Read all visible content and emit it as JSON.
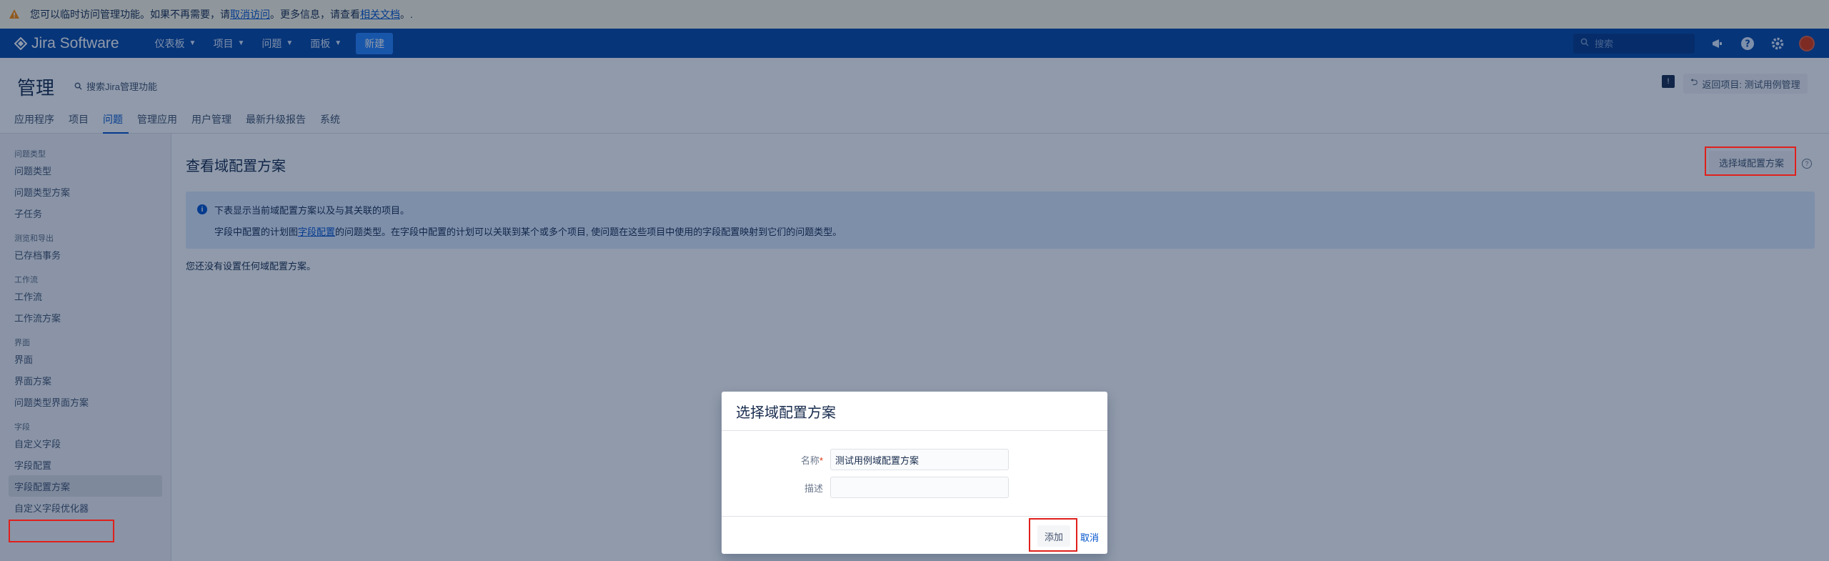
{
  "banner": {
    "text_before": "您可以临时访问管理功能。如果不再需要，请 ",
    "link1": "取消访问",
    "text_middle": "。更多信息，请查看 ",
    "link2": "相关文档",
    "text_after": "。."
  },
  "topnav": {
    "product": "Jira Software",
    "menu": [
      "仪表板",
      "项目",
      "问题",
      "面板"
    ],
    "create": "新建",
    "search_placeholder": "搜索"
  },
  "admin": {
    "title": "管理",
    "search": "搜索Jira管理功能",
    "tabs": [
      "应用程序",
      "项目",
      "问题",
      "管理应用",
      "用户管理",
      "最新升级报告",
      "系统"
    ],
    "active_tab": "问题",
    "back_button": "返回项目: 测试用例管理"
  },
  "sidebar": {
    "sections": [
      {
        "title": "问题类型",
        "items": [
          "问题类型",
          "问题类型方案",
          "子任务"
        ]
      },
      {
        "title": "测览和导出",
        "items": [
          "已存档事务"
        ]
      },
      {
        "title": "工作流",
        "items": [
          "工作流",
          "工作流方案"
        ]
      },
      {
        "title": "界面",
        "items": [
          "界面",
          "界面方案",
          "问题类型界面方案"
        ]
      },
      {
        "title": "字段",
        "items": [
          "自定义字段",
          "字段配置",
          "字段配置方案",
          "自定义字段优化器"
        ]
      }
    ],
    "selected": "字段配置方案"
  },
  "main": {
    "title": "查看域配置方案",
    "choose_button": "选择域配置方案",
    "info_line1": "下表显示当前域配置方案以及与其关联的项目。",
    "info_line2_before": "字段中配置的计划图",
    "info_line2_link": "字段配置",
    "info_line2_after": "的问题类型。在字段中配置的计划可以关联到某个或多个项目, 使问题在这些项目中使用的字段配置映射到它们的问题类型。",
    "empty": "您还没有设置任何域配置方案。"
  },
  "dialog": {
    "title": "选择域配置方案",
    "name_label": "名称",
    "name_value": "测试用例域配置方案",
    "desc_label": "描述",
    "desc_value": "",
    "add_button": "添加",
    "cancel_link": "取消"
  },
  "colors": {
    "nav_bg": "#0747a6",
    "accent": "#0052cc",
    "highlight": "#e0201c"
  }
}
